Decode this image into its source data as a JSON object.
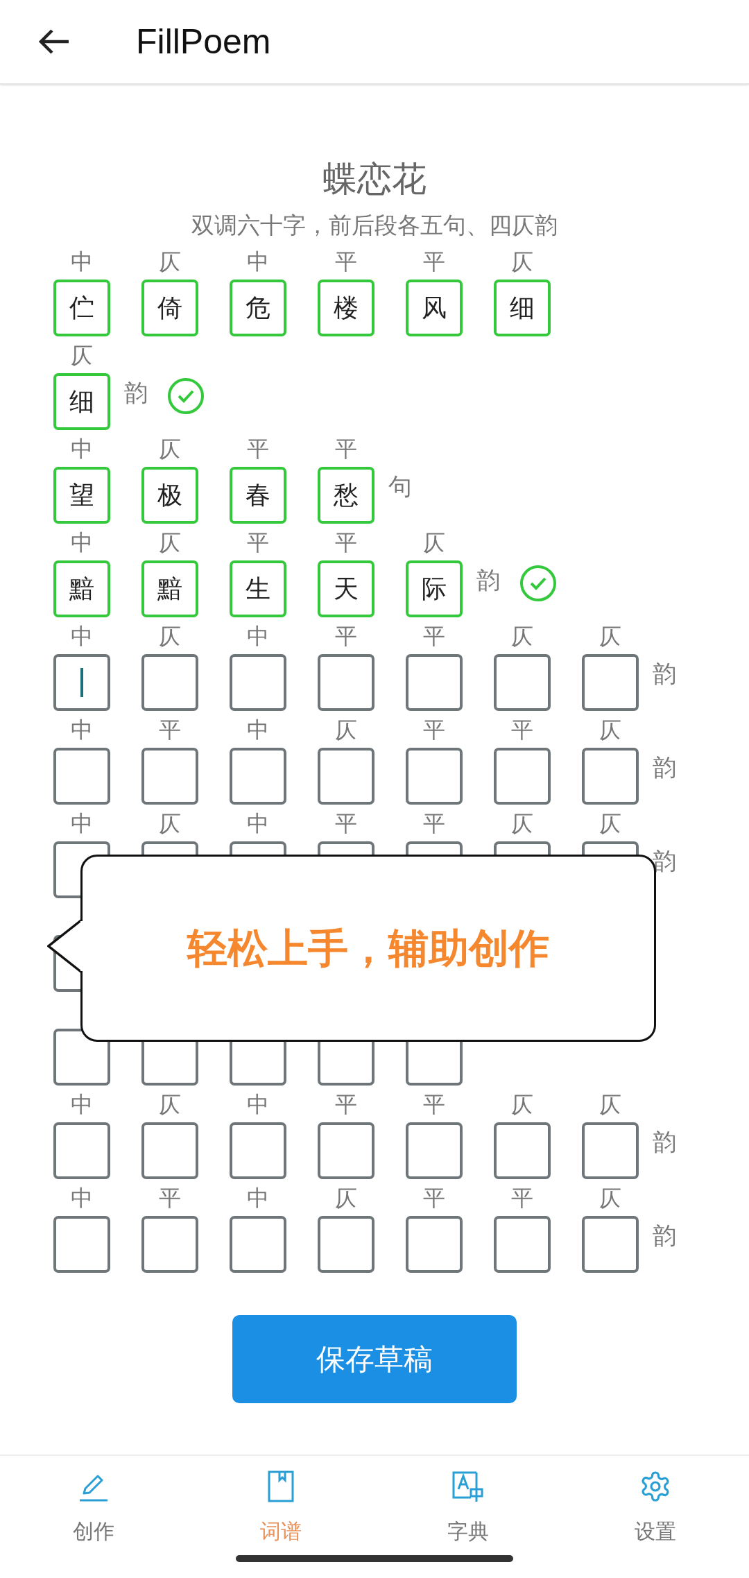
{
  "app_bar": {
    "title": "FillPoem"
  },
  "poem": {
    "title": "蝶恋花",
    "description": "双调六十字，前后段各五句、四仄韵"
  },
  "lines": [
    {
      "cells": [
        {
          "tone": "中",
          "char": "伫",
          "filled": true
        },
        {
          "tone": "仄",
          "char": "倚",
          "filled": true
        },
        {
          "tone": "中",
          "char": "危",
          "filled": true
        },
        {
          "tone": "平",
          "char": "楼",
          "filled": true
        },
        {
          "tone": "平",
          "char": "风",
          "filled": true
        },
        {
          "tone": "仄",
          "char": "细",
          "filled": true
        }
      ]
    },
    {
      "cells": [
        {
          "tone": "仄",
          "char": "细",
          "filled": true
        }
      ],
      "end": "韵",
      "checked": true
    },
    {
      "cells": [
        {
          "tone": "中",
          "char": "望",
          "filled": true
        },
        {
          "tone": "仄",
          "char": "极",
          "filled": true
        },
        {
          "tone": "平",
          "char": "春",
          "filled": true
        },
        {
          "tone": "平",
          "char": "愁",
          "filled": true
        }
      ],
      "end": "句"
    },
    {
      "cells": [
        {
          "tone": "中",
          "char": "黯",
          "filled": true
        },
        {
          "tone": "仄",
          "char": "黯",
          "filled": true
        },
        {
          "tone": "平",
          "char": "生",
          "filled": true
        },
        {
          "tone": "平",
          "char": "天",
          "filled": true
        },
        {
          "tone": "仄",
          "char": "际",
          "filled": true
        }
      ],
      "end": "韵",
      "checked": true
    },
    {
      "cells": [
        {
          "tone": "中",
          "filled": false,
          "cursor": true
        },
        {
          "tone": "仄",
          "filled": false
        },
        {
          "tone": "中",
          "filled": false
        },
        {
          "tone": "平",
          "filled": false
        },
        {
          "tone": "平",
          "filled": false
        },
        {
          "tone": "仄",
          "filled": false
        },
        {
          "tone": "仄",
          "filled": false
        }
      ],
      "end": "韵"
    },
    {
      "cells": [
        {
          "tone": "中",
          "filled": false
        },
        {
          "tone": "平",
          "filled": false
        },
        {
          "tone": "中",
          "filled": false
        },
        {
          "tone": "仄",
          "filled": false
        },
        {
          "tone": "平",
          "filled": false
        },
        {
          "tone": "平",
          "filled": false
        },
        {
          "tone": "仄",
          "filled": false
        }
      ],
      "end": "韵"
    },
    {
      "cells": [
        {
          "tone": "中",
          "filled": false
        },
        {
          "tone": "仄",
          "filled": false
        },
        {
          "tone": "中",
          "filled": false
        },
        {
          "tone": "平",
          "filled": false
        },
        {
          "tone": "平",
          "filled": false
        },
        {
          "tone": "仄",
          "filled": false
        },
        {
          "tone": "仄",
          "filled": false
        }
      ],
      "end": "韵"
    },
    {
      "cells": [
        {
          "filled": false
        }
      ]
    },
    {
      "cells": [
        {
          "filled": false
        },
        {
          "filled": false
        },
        {
          "filled": false
        },
        {
          "filled": false
        },
        {
          "filled": false
        }
      ]
    },
    {
      "cells": [
        {
          "tone": "中",
          "filled": false
        },
        {
          "tone": "仄",
          "filled": false
        },
        {
          "tone": "中",
          "filled": false
        },
        {
          "tone": "平",
          "filled": false
        },
        {
          "tone": "平",
          "filled": false
        },
        {
          "tone": "仄",
          "filled": false
        },
        {
          "tone": "仄",
          "filled": false
        }
      ],
      "end": "韵"
    },
    {
      "cells": [
        {
          "tone": "中",
          "filled": false
        },
        {
          "tone": "平",
          "filled": false
        },
        {
          "tone": "中",
          "filled": false
        },
        {
          "tone": "仄",
          "filled": false
        },
        {
          "tone": "平",
          "filled": false
        },
        {
          "tone": "平",
          "filled": false
        },
        {
          "tone": "仄",
          "filled": false
        }
      ],
      "end": "韵"
    }
  ],
  "tooltip": {
    "text": "轻松上手，辅助创作"
  },
  "save_button": {
    "label": "保存草稿"
  },
  "bottom_nav": [
    {
      "kind": "pencil",
      "label": "创作",
      "selected": false
    },
    {
      "kind": "book",
      "label": "词谱",
      "selected": true
    },
    {
      "kind": "dictionary",
      "label": "字典",
      "selected": false
    },
    {
      "kind": "gear",
      "label": "设置",
      "selected": false
    }
  ]
}
